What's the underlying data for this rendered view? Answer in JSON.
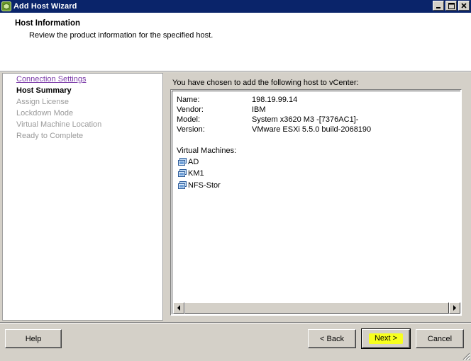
{
  "window": {
    "title": "Add Host Wizard",
    "icon": "vsphere-host-icon"
  },
  "header": {
    "title": "Host Information",
    "subtitle": "Review the product information for the specified host."
  },
  "nav": {
    "items": [
      {
        "label": "Connection Settings",
        "state": "link"
      },
      {
        "label": "Host Summary",
        "state": "current"
      },
      {
        "label": "Assign License",
        "state": "disabled"
      },
      {
        "label": "Lockdown Mode",
        "state": "disabled"
      },
      {
        "label": "Virtual Machine Location",
        "state": "disabled"
      },
      {
        "label": "Ready to Complete",
        "state": "disabled"
      }
    ]
  },
  "content": {
    "intro": "You have chosen to add the following host to vCenter:",
    "properties": [
      {
        "key": "Name:",
        "value": "198.19.99.14"
      },
      {
        "key": "Vendor:",
        "value": "IBM"
      },
      {
        "key": "Model:",
        "value": "System x3620 M3 -[7376AC1]-"
      },
      {
        "key": "Version:",
        "value": "VMware ESXi 5.5.0 build-2068190"
      }
    ],
    "vm_heading": "Virtual Machines:",
    "vms": [
      "AD",
      "KM1",
      "NFS-Stor"
    ]
  },
  "buttons": {
    "help": "Help",
    "back": "< Back",
    "next": "Next >",
    "cancel": "Cancel"
  },
  "colors": {
    "titlebar": "#0a246a",
    "link": "#7a3aa8",
    "highlight": "#f7ff1e"
  }
}
